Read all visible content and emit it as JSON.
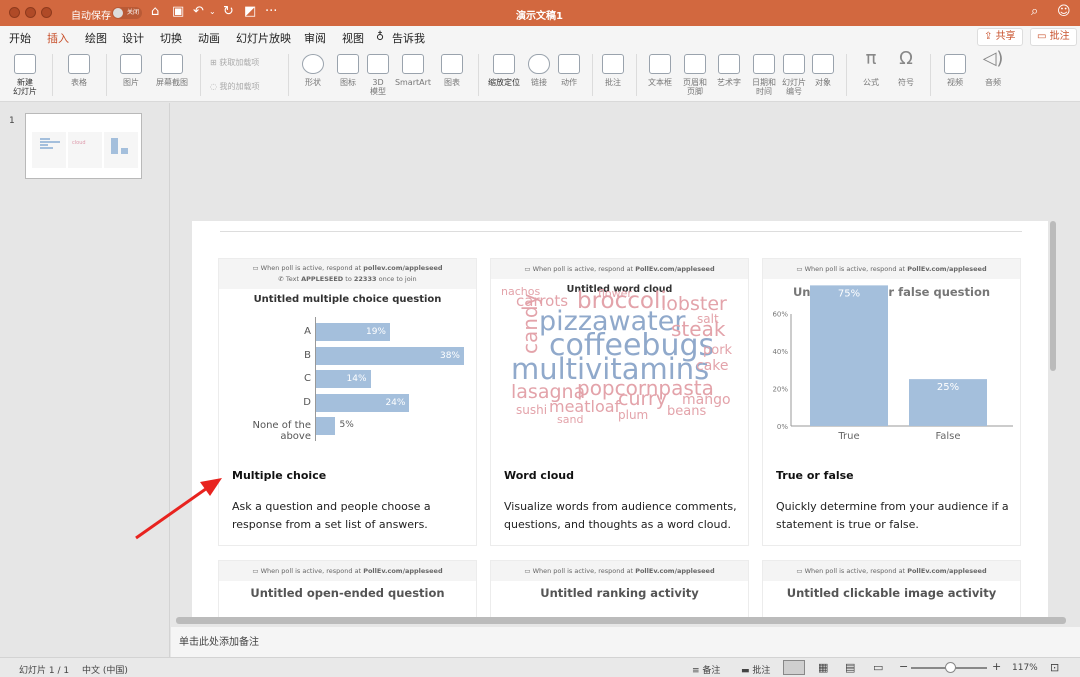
{
  "titlebar": {
    "autosave": "自动保存",
    "autosave_state": "关闭",
    "doc_title": "演示文稿1"
  },
  "menu": {
    "items": [
      "开始",
      "插入",
      "绘图",
      "设计",
      "切换",
      "动画",
      "幻灯片放映",
      "审阅",
      "视图",
      "告诉我"
    ],
    "active": "插入",
    "share": "共享",
    "comment": "批注"
  },
  "ribbon": {
    "new_slide": "新建\n幻灯片",
    "table": "表格",
    "picture": "图片",
    "screenshot": "屏幕截图",
    "get_addins": "获取加载项",
    "my_addins": "我的加载项",
    "shapes": "形状",
    "icons": "图标",
    "model3d": "3D\n模型",
    "smartart": "SmartArt",
    "chart": "图表",
    "zoom": "缩放定位",
    "link": "链接",
    "action": "动作",
    "comment": "批注",
    "textbox": "文本框",
    "header_footer": "页眉和\n页脚",
    "wordart": "艺术字",
    "datetime": "日期和\n时间",
    "slide_number": "幻灯片\n编号",
    "object": "对象",
    "equation": "公式",
    "symbol": "符号",
    "video": "视频",
    "audio": "音频"
  },
  "thumbnail": {
    "number": "1"
  },
  "slide": {
    "respond_text": "When poll is active, respond at",
    "url_mc": "pollev.com/appleseed",
    "url": "PollEv.com/appleseed",
    "text_line_prefix": "Text",
    "text_code": "APPLESEED",
    "text_mid": "to",
    "text_number": "22333",
    "text_suffix": "once to join",
    "cards": [
      {
        "title": "Untitled multiple choice question",
        "name": "Multiple choice",
        "desc": "Ask a question and people choose a response from a set list of answers."
      },
      {
        "title": "Untitled word cloud",
        "name": "Word cloud",
        "desc": "Visualize words from audience comments, questions, and thoughts as a word cloud."
      },
      {
        "title": "Untitled true or false question",
        "name": "True or false",
        "desc": "Quickly determine from your audience if a statement is true or false."
      },
      {
        "title": "Untitled open-ended question"
      },
      {
        "title": "Untitled ranking activity"
      },
      {
        "title": "Untitled clickable image activity"
      }
    ]
  },
  "chart_data": [
    {
      "type": "bar",
      "orientation": "horizontal",
      "title": "Untitled multiple choice question",
      "categories": [
        "A",
        "B",
        "C",
        "D",
        "None of the above"
      ],
      "values": [
        19,
        38,
        14,
        24,
        5
      ],
      "labels": [
        "19%",
        "38%",
        "14%",
        "24%",
        "5%"
      ],
      "color": "#a4bfdc"
    },
    {
      "type": "bar",
      "title": "Untitled true or false question",
      "categories": [
        "True",
        "False"
      ],
      "values": [
        75,
        25
      ],
      "labels": [
        "75%",
        "25%"
      ],
      "yticks": [
        "0%",
        "20%",
        "40%",
        "60%"
      ],
      "ylim": [
        0,
        80
      ],
      "color": "#a4bfdc"
    }
  ],
  "wordcloud": {
    "words": [
      "nachos",
      "flower",
      "carrots",
      "broccoli",
      "lobster",
      "candy",
      "salt",
      "pizzawater",
      "steak",
      "coffeebugs",
      "pork",
      "multivitamins",
      "cake",
      "lasagna",
      "popcornpasta",
      "curry",
      "mango",
      "meatloaf",
      "sushi",
      "beans",
      "sand",
      "plum"
    ],
    "colors": {
      "blue": "#90a9cb",
      "pink": "#e3a3aa"
    }
  },
  "notes": "单击此处添加备注",
  "status": {
    "slide": "幻灯片 1 / 1",
    "lang": "中文 (中国)",
    "notes": "备注",
    "comments": "批注",
    "zoom": "117%"
  }
}
